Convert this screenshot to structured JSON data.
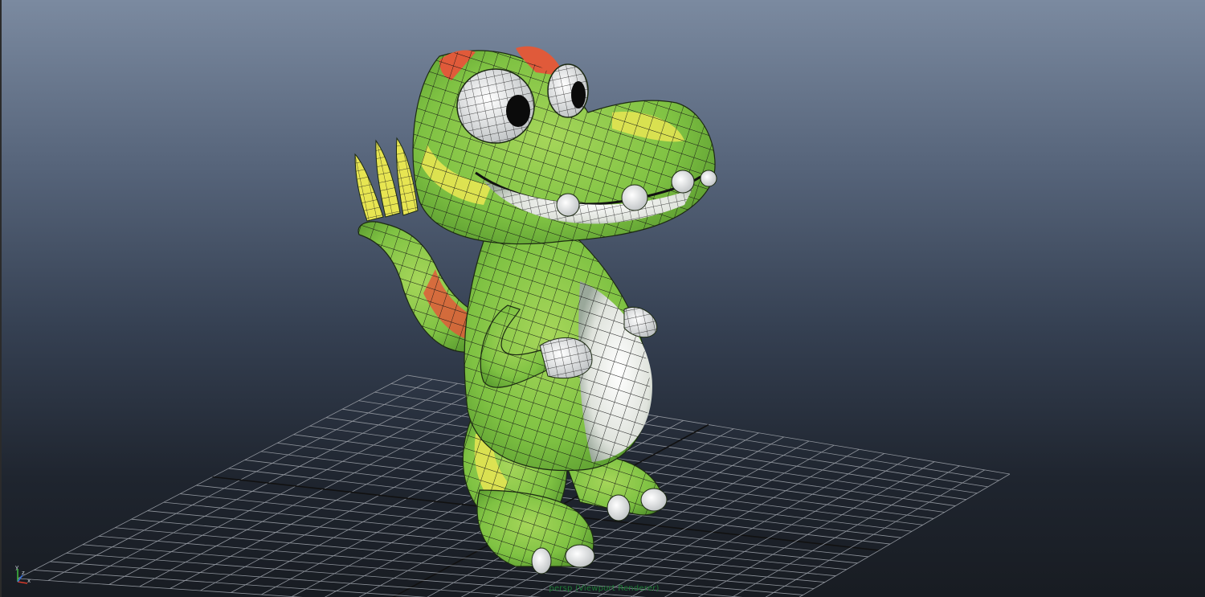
{
  "viewport": {
    "camera_label": "persp (Viewport Renderer)",
    "axis_labels": {
      "y": "y",
      "x": "x",
      "z": "z"
    },
    "colors": {
      "grid_line": "#8f949c",
      "grid_axis": "#111111",
      "axis_x": "#d23a2a",
      "axis_y": "#3fbf3f",
      "axis_z": "#3a6fd8",
      "model_green": "#7fc243",
      "model_yellow": "#e7e552",
      "model_red": "#e05a3a",
      "model_white": "#e9ebe6",
      "wire": "#141414"
    }
  },
  "model": {
    "name": "cartoon-dinosaur"
  }
}
